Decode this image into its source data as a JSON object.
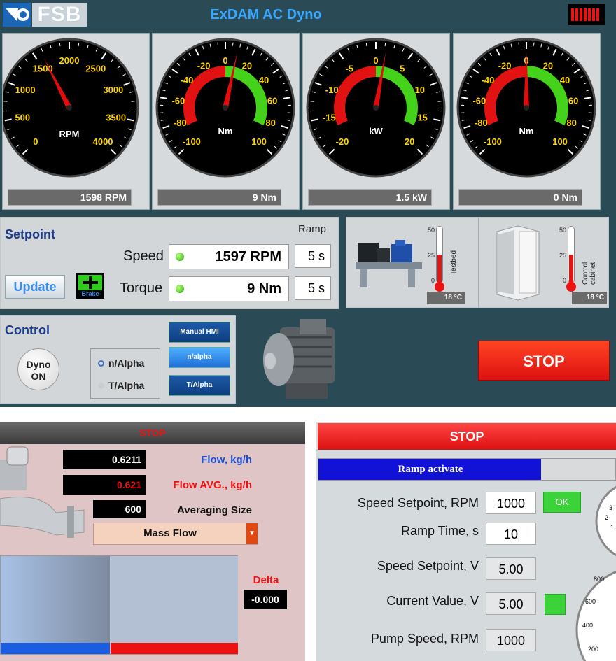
{
  "header": {
    "logo_text": "FSB",
    "title": "ExDAM AC Dyno"
  },
  "gauges": [
    {
      "unit": "RPM",
      "ticks": [
        "0",
        "500",
        "1000",
        "1500",
        "2000",
        "2500",
        "3000",
        "3500",
        "4000"
      ],
      "value": 1598,
      "min": 0,
      "max": 4000,
      "readout": "1598 RPM"
    },
    {
      "unit": "Nm",
      "ticks": [
        "-100",
        "-80",
        "-60",
        "-40",
        "-20",
        "0",
        "20",
        "40",
        "60",
        "80",
        "100"
      ],
      "value": 9,
      "min": -100,
      "max": 100,
      "readout": "9 Nm"
    },
    {
      "unit": "kW",
      "ticks": [
        "-20",
        "-15",
        "-10",
        "-5",
        "0",
        "5",
        "10",
        "15",
        "20"
      ],
      "value": 1.5,
      "min": -20,
      "max": 20,
      "readout": "1.5 kW"
    },
    {
      "unit": "Nm",
      "ticks": [
        "-100",
        "-80",
        "-60",
        "-40",
        "-20",
        "0",
        "20",
        "40",
        "60",
        "80",
        "100"
      ],
      "value": 0,
      "min": -100,
      "max": 100,
      "readout": "0 Nm"
    }
  ],
  "setpoint": {
    "label": "Setpoint",
    "ramp_label": "Ramp",
    "speed_label": "Speed",
    "speed_value": "1597 RPM",
    "speed_ramp": "5 s",
    "torque_label": "Torque",
    "torque_value": "9 Nm",
    "torque_ramp": "5 s",
    "update_button": "Update",
    "brake_label": "Brake"
  },
  "temps": {
    "testbed_label": "Testbed",
    "testbed_value": "18 °C",
    "cabinet_label": "Control cabinet",
    "cabinet_value": "18 °C",
    "scale": [
      "50",
      "25",
      "0"
    ]
  },
  "control": {
    "label": "Control",
    "dyno_button": "Dyno ON",
    "radio1": "n/Alpha",
    "radio2": "T/Alpha",
    "btn_manual": "Manual HMI",
    "btn_nalpha": "n/alpha",
    "btn_talpha": "T/Alpha"
  },
  "stop_button": "STOP",
  "flow": {
    "header": "STOP",
    "flow_value": "0.6211",
    "flow_label": "Flow, kg/h",
    "avg_value": "0.621",
    "avg_label": "Flow AVG., kg/h",
    "size_value": "600",
    "size_label": "Averaging Size",
    "mode": "Mass Flow",
    "delta_label": "Delta",
    "delta_value": "-0.000"
  },
  "pump": {
    "stop": "STOP",
    "ramp_activate": "Ramp activate",
    "ramp_fill": 0.75,
    "speed_sp_label": "Speed Setpoint, RPM",
    "speed_sp": "1000",
    "ok": "OK",
    "ramp_time_label": "Ramp Time, s",
    "ramp_time": "10",
    "speed_sp_v_label": "Speed Setpoint, V",
    "speed_sp_v": "5.00",
    "current_v_label": "Current Value, V",
    "current_v": "5.00",
    "pump_speed_label": "Pump Speed, RPM",
    "pump_speed": "1000",
    "dial_ticks_top": [
      "3",
      "2",
      "1"
    ],
    "dial_ticks_bottom": [
      "800",
      "600",
      "400",
      "200"
    ]
  },
  "colors": {
    "accent": "#36a8ff",
    "stop": "#ee2222",
    "led": "#3cc21c"
  }
}
